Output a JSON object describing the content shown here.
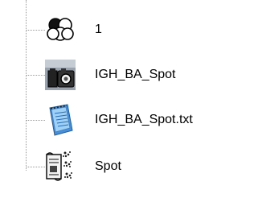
{
  "tree": {
    "items": [
      {
        "label": "1",
        "icon": "three-circles-icon"
      },
      {
        "label": "IGH_BA_Spot",
        "icon": "camera-icon"
      },
      {
        "label": "IGH_BA_Spot.txt",
        "icon": "notepad-icon"
      },
      {
        "label": "Spot",
        "icon": "scroll-icon"
      }
    ]
  }
}
